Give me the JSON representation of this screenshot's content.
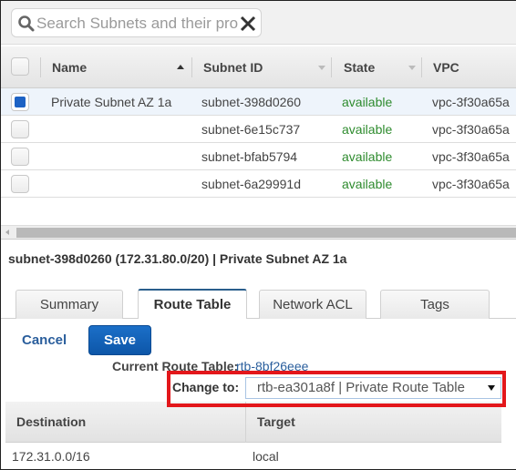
{
  "search": {
    "placeholder": "Search Subnets and their prop",
    "value": ""
  },
  "table": {
    "columns": [
      {
        "label": "Name",
        "sort": "ascending"
      },
      {
        "label": "Subnet ID",
        "sort": "none"
      },
      {
        "label": "State",
        "sort": "none"
      },
      {
        "label": "VPC",
        "sort": "none"
      }
    ],
    "rows": [
      {
        "selected": true,
        "name": "Private Subnet AZ 1a",
        "subnet_id": "subnet-398d0260",
        "state": "available",
        "vpc": "vpc-3f30a65a"
      },
      {
        "selected": false,
        "name": "",
        "subnet_id": "subnet-6e15c737",
        "state": "available",
        "vpc": "vpc-3f30a65a"
      },
      {
        "selected": false,
        "name": "",
        "subnet_id": "subnet-bfab5794",
        "state": "available",
        "vpc": "vpc-3f30a65a"
      },
      {
        "selected": false,
        "name": "",
        "subnet_id": "subnet-6a29991d",
        "state": "available",
        "vpc": "vpc-3f30a65a"
      }
    ]
  },
  "detail": {
    "title": "subnet-398d0260 (172.31.80.0/20) | Private Subnet AZ 1a",
    "tabs": [
      {
        "label": "Summary",
        "active": false
      },
      {
        "label": "Route Table",
        "active": true
      },
      {
        "label": "Network ACL",
        "active": false
      },
      {
        "label": "Tags",
        "active": false
      }
    ],
    "cancel_label": "Cancel",
    "save_label": "Save",
    "current_route_table_label": "Current Route Table:",
    "current_route_table_value": "rtb-8bf26eee",
    "change_to_label": "Change to:",
    "change_to_selected": "rtb-ea301a8f | Private Route Table",
    "routes": {
      "columns": [
        "Destination",
        "Target"
      ],
      "rows": [
        {
          "destination": "172.31.0.0/16",
          "target": "local"
        }
      ]
    }
  },
  "colors": {
    "accent": "#1d62c4",
    "available": "#2e8b2e",
    "highlight": "#e3171b",
    "link": "#2a5e9c"
  }
}
